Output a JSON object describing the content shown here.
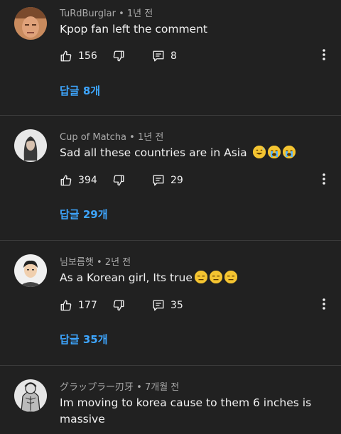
{
  "comments": [
    {
      "author": "TuRdBurglar",
      "time": "1년 전",
      "text": "Kpop fan left the comment",
      "likes": "156",
      "replies_count": "8",
      "replies_link": "답글 8개",
      "emojis": []
    },
    {
      "author": "Cup of Matcha",
      "time": "1년 전",
      "text": "Sad all these countries are in Asia",
      "likes": "394",
      "replies_count": "29",
      "replies_link": "답글 29개",
      "emojis": [
        "sweat-smile-emoji-icon",
        "crying-face-emoji-icon",
        "crying-face-emoji-icon"
      ]
    },
    {
      "author": "님보름햇",
      "time": "2년 전",
      "text": "As a Korean girl, Its true",
      "likes": "177",
      "replies_count": "35",
      "replies_link": "답글 35개",
      "emojis": [
        "expressionless-face-emoji-icon",
        "expressionless-face-emoji-icon",
        "expressionless-face-emoji-icon"
      ]
    },
    {
      "author": "グラップラー刃牙",
      "time": "7개월 전",
      "text": "Im moving to korea cause to them 6 inches is massive"
    }
  ],
  "separator": "•",
  "colors": {
    "background": "#212121",
    "text": "#f1f1f1",
    "meta": "#aaaaaa",
    "link": "#3ea6ff",
    "divider": "#3a3a3a"
  }
}
